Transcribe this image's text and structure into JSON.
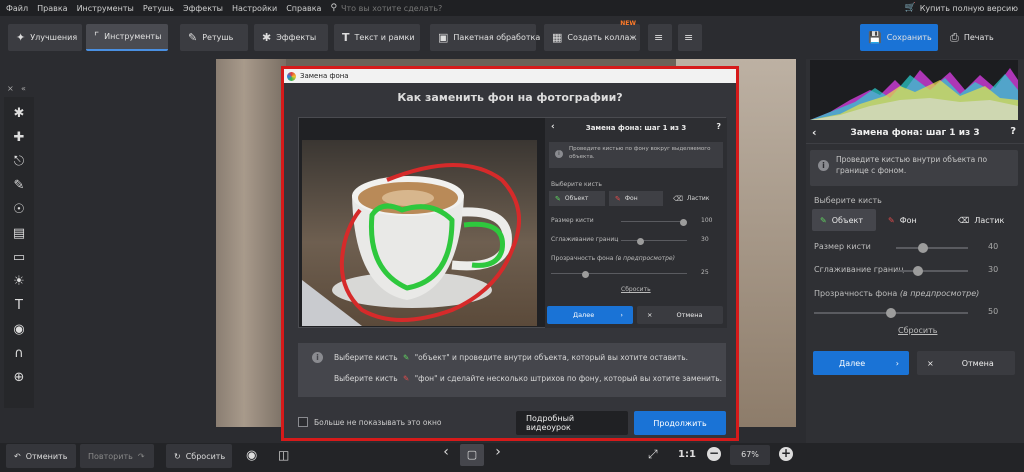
{
  "menu": {
    "items": [
      "Файл",
      "Правка",
      "Инструменты",
      "Ретушь",
      "Эффекты",
      "Настройки",
      "Справка"
    ],
    "search_placeholder": "Что вы хотите сделать?",
    "buy_label": "Купить полную версию"
  },
  "toolbar": {
    "improve": "Улучшения",
    "tools": "Инструменты",
    "retouch": "Ретушь",
    "effects": "Эффекты",
    "text_frames": "Текст и рамки",
    "batch": "Пакетная обработка",
    "collage": "Создать коллаж",
    "collage_badge": "NEW",
    "save": "Сохранить",
    "print": "Печать"
  },
  "right_panel": {
    "title": "Замена фона: шаг 1 из 3",
    "hint": "Проведите кистью внутри объекта по границе с фоном.",
    "choose_brush": "Выберите кисть",
    "brush_object": "Объект",
    "brush_background": "Фон",
    "brush_eraser": "Ластик",
    "brush_size_label": "Размер кисти",
    "brush_size_value": "40",
    "brush_size_fraction": 0.38,
    "smoothing_label": "Сглаживание границ",
    "smoothing_value": "30",
    "smoothing_fraction": 0.3,
    "opacity_label": "Прозрачность фона",
    "opacity_note": "(в предпросмотре)",
    "opacity_value": "50",
    "opacity_fraction": 0.5,
    "reset_link": "Сбросить",
    "next": "Далее",
    "cancel": "Отмена"
  },
  "bottom": {
    "undo": "Отменить",
    "redo": "Повторить",
    "reset": "Сбросить",
    "ratio": "1:1",
    "zoom": "67%"
  },
  "dialog": {
    "window_title": "Замена фона",
    "heading": "Как заменить фон на фотографии?",
    "mini_title": "Замена фона: шаг 1 из 3",
    "mini_hint": "Проведите кистью по фону вокруг выделяемого объекта.",
    "choose_brush": "Выберите кисть",
    "brush_object": "Объект",
    "brush_background": "Фон",
    "brush_eraser": "Ластик",
    "brush_size_label": "Размер кисти",
    "brush_size_value": "100",
    "brush_size_fraction": 0.95,
    "smoothing_label": "Сглаживание границ",
    "smoothing_value": "30",
    "smoothing_fraction": 0.3,
    "opacity_label": "Прозрачность фона",
    "opacity_note": "(в предпросмотре)",
    "opacity_value": "25",
    "opacity_fraction": 0.25,
    "reset_link": "Сбросить",
    "next": "Далее",
    "cancel": "Отмена",
    "info_line1_a": "Выберите кисть",
    "info_line1_b": "\"объект\" и проведите внутри объекта, который вы хотите оставить.",
    "info_line2_a": "Выберите кисть",
    "info_line2_b": "\"фон\" и сделайте несколько штрихов по фону, который вы хотите заменить.",
    "dont_show": "Больше не показывать это окно",
    "video": "Подробный видеоурок",
    "continue": "Продолжить"
  }
}
